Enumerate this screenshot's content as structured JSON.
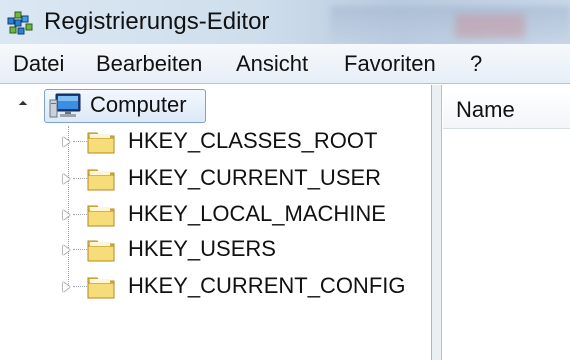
{
  "window": {
    "title": "Registrierungs-Editor"
  },
  "menu": {
    "items": [
      "Datei",
      "Bearbeiten",
      "Ansicht",
      "Favoriten",
      "?"
    ]
  },
  "tree": {
    "root": {
      "label": "Computer",
      "icon": "computer-icon",
      "expanded": true,
      "selected": true
    },
    "nodes": [
      {
        "label": "HKEY_CLASSES_ROOT",
        "icon": "folder-icon"
      },
      {
        "label": "HKEY_CURRENT_USER",
        "icon": "folder-icon"
      },
      {
        "label": "HKEY_LOCAL_MACHINE",
        "icon": "folder-icon"
      },
      {
        "label": "HKEY_USERS",
        "icon": "folder-icon"
      },
      {
        "label": "HKEY_CURRENT_CONFIG",
        "icon": "folder-icon"
      }
    ]
  },
  "list": {
    "columns": [
      "Name"
    ]
  }
}
